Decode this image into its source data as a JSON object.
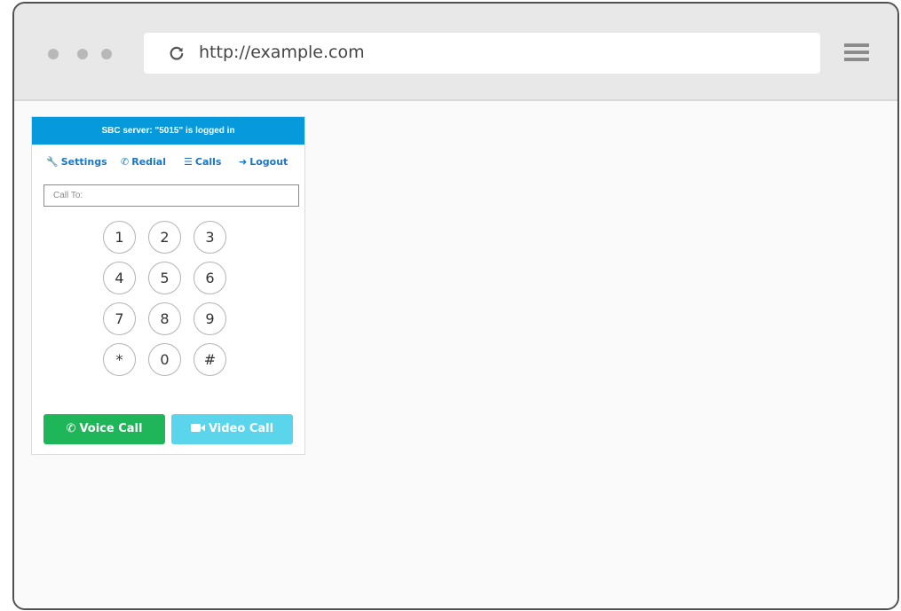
{
  "browser": {
    "url": "http://example.com"
  },
  "phone": {
    "status": "SBC server: \"5015\" is logged in",
    "nav": {
      "settings": "Settings",
      "redial": "Redial",
      "calls": "Calls",
      "logout": "Logout"
    },
    "call_to_placeholder": "Call To:",
    "keys": [
      "1",
      "2",
      "3",
      "4",
      "5",
      "6",
      "7",
      "8",
      "9",
      "*",
      "0",
      "#"
    ],
    "voice_call": "Voice Call",
    "video_call": "Video Call",
    "colors": {
      "header": "#0699dc",
      "link": "#1a76c2",
      "voice": "#1fb65a",
      "video": "#5bd5ec"
    }
  },
  "icons": {
    "reload": "reload-icon",
    "menu": "hamburger-menu-icon",
    "settings": "wrench-icon",
    "redial": "phone-icon",
    "calls": "list-icon",
    "logout": "sign-out-icon",
    "voice": "phone-icon",
    "video": "video-camera-icon"
  }
}
